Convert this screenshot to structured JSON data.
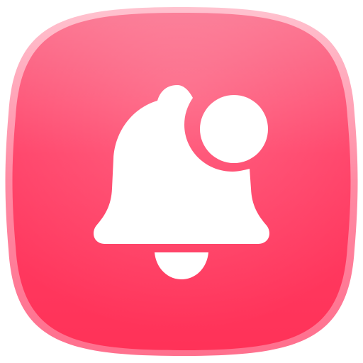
{
  "app_icon": {
    "name": "notification-bell",
    "icon": "bell-icon",
    "badge_icon": "notification-dot-icon",
    "colors": {
      "background": "#ffffff",
      "tile_top": "#fb6f8c",
      "tile_mid": "#ff3f66",
      "tile_bottom": "#ff3258",
      "tile_rim": "#ffb3c2",
      "glyph": "#ffffff"
    }
  }
}
